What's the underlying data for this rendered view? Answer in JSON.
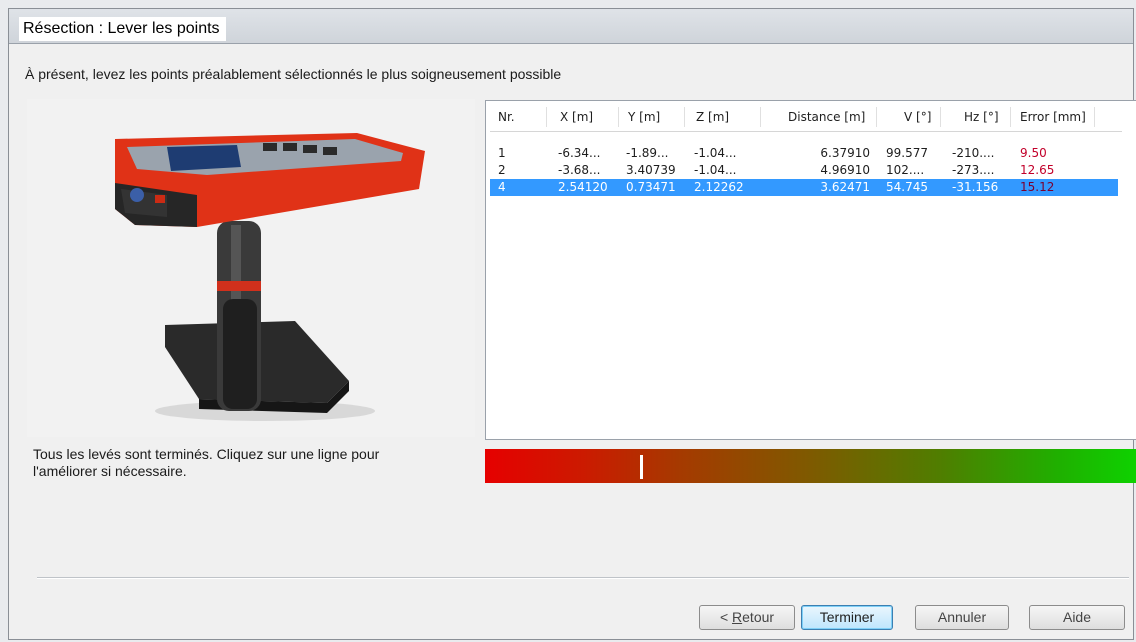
{
  "window": {
    "title": "Résection : Lever les points"
  },
  "instruction": "À présent, levez les points préalablement sélectionnés le plus soigneusement possible",
  "device_image": {
    "description_icon": "laser-distance-meter-image"
  },
  "table": {
    "columns": [
      "Nr.",
      "X [m]",
      "Y [m]",
      "Z [m]",
      "Distance [m]",
      "V [°]",
      "Hz [°]",
      "Error [mm]"
    ],
    "rows": [
      {
        "nr": "1",
        "x": "-6.34...",
        "y": "-1.89...",
        "z": "-1.04...",
        "distance": "6.37910",
        "v": "99.577",
        "hz": "-210....",
        "error": "9.50",
        "selected": false
      },
      {
        "nr": "2",
        "x": "-3.68...",
        "y": "3.40739",
        "z": "-1.04...",
        "distance": "4.96910",
        "v": "102....",
        "hz": "-273....",
        "error": "12.65",
        "selected": false
      },
      {
        "nr": "4",
        "x": "2.54120",
        "y": "0.73471",
        "z": "2.12262",
        "distance": "3.62471",
        "v": "54.745",
        "hz": "-31.156",
        "error": "15.12",
        "selected": true
      }
    ]
  },
  "status": {
    "line1": "Tous les levés sont terminés. Cliquez sur une ligne pour",
    "line2": "l'améliorer si nécessaire."
  },
  "quality": {
    "marker_fraction": 0.24,
    "color_low": "#e60000",
    "color_high": "#0ed200"
  },
  "buttons": {
    "back": {
      "prefix": "< ",
      "mnemonic": "R",
      "rest": "etour"
    },
    "finish": "Terminer",
    "cancel": "Annuler",
    "help": "Aide"
  }
}
